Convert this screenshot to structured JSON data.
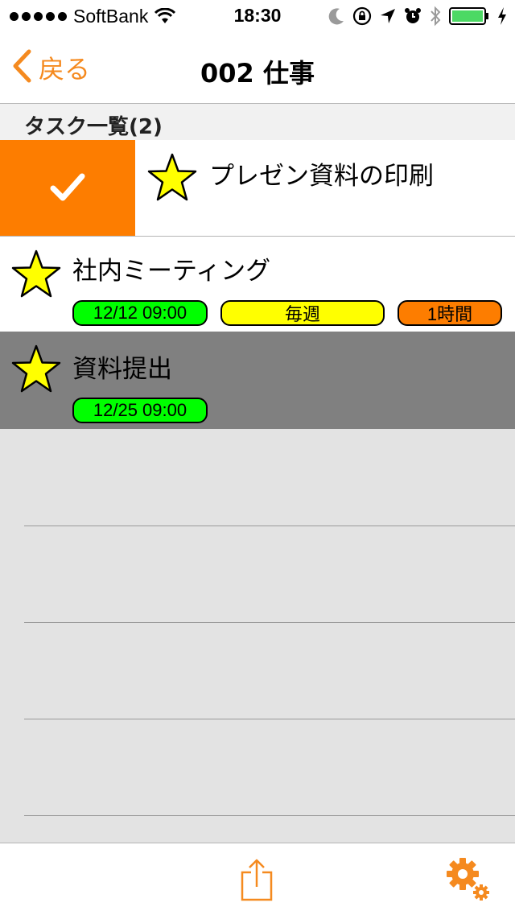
{
  "status_bar": {
    "carrier": "SoftBank",
    "time": "18:30",
    "icons": [
      "signal-dots-icon",
      "wifi-icon",
      "moon-icon",
      "orientation-lock-icon",
      "location-icon",
      "alarm-icon",
      "bluetooth-icon",
      "battery-icon",
      "charging-icon"
    ]
  },
  "nav": {
    "back_label": "戻る",
    "title": "002 仕事"
  },
  "section": {
    "label": "タスク一覧(2)"
  },
  "tasks": [
    {
      "title": "プレゼン資料の印刷",
      "completed": true,
      "starred": true
    },
    {
      "title": "社内ミーティング",
      "starred": true,
      "date": "12/12 09:00",
      "repeat": "毎週",
      "alarm": "1時間"
    },
    {
      "title": "資料提出",
      "starred": true,
      "selected": true,
      "date": "12/25 09:00"
    }
  ],
  "toolbar": {
    "icons": [
      "share-icon",
      "settings-icon"
    ]
  },
  "colors": {
    "accent": "#f58a1f",
    "complete": "#fd7d00",
    "date_pill": "#00ff00",
    "repeat_pill": "#ffff00",
    "alarm_pill": "#fd7d00",
    "star": "#ffff00",
    "selected_row": "#808080",
    "background": "#e3e3e3"
  }
}
